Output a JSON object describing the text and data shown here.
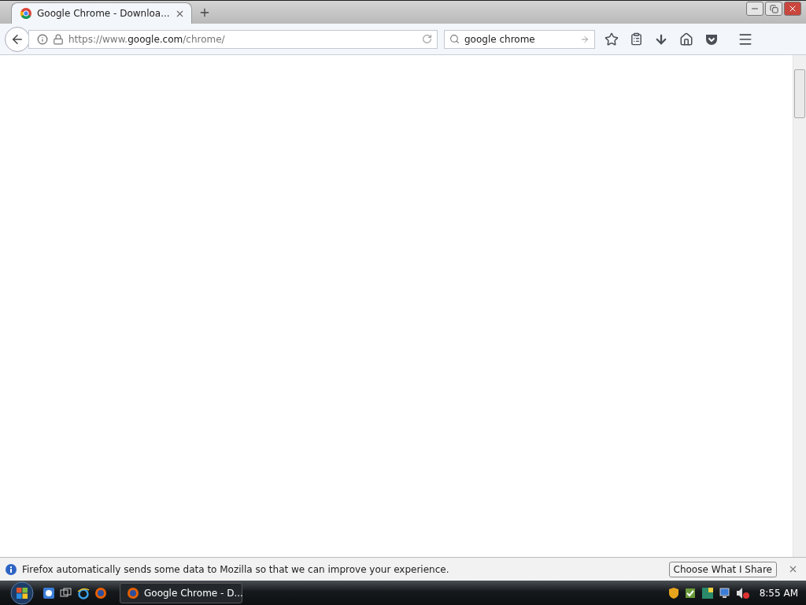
{
  "tabs": [
    {
      "title": "Google Chrome - Downloa...",
      "selected": true
    }
  ],
  "address": {
    "url_prefix": "https://www.",
    "url_domain": "google.com",
    "url_path": "/chrome/"
  },
  "search": {
    "value": "google chrome"
  },
  "notification": {
    "text": "Firefox automatically sends some data to Mozilla so that we can improve your experience.",
    "button": "Choose What I Share"
  },
  "taskbar": {
    "windows": [
      {
        "title": "Google Chrome - D...",
        "selected": true
      }
    ],
    "clock": "8:55 AM"
  }
}
